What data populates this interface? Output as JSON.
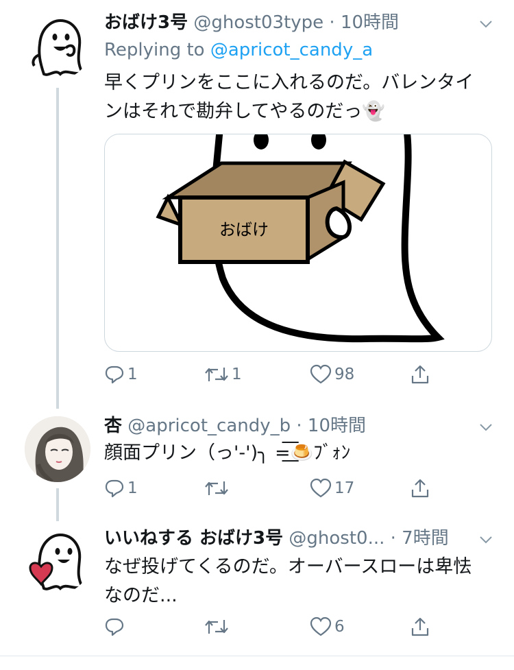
{
  "tweets": [
    {
      "name": "おばけ3号",
      "handle": "@ghost03type",
      "time": "· 10時間",
      "replying_prefix": "Replying to",
      "replying_handle": "@apricot_candy_a",
      "text_line1": "早くプリンをここに入れるのだ。バレンタイ",
      "text_line2": "ンはそれで勘弁してやるのだっ👻",
      "image_label": "おばけ",
      "replies": "1",
      "retweets": "1",
      "likes": "98"
    },
    {
      "name": "杏",
      "handle": "@apricot_candy_b",
      "time": "· 10時間",
      "text": "顔面プリン（っ'-')╮ =͟͟͞͞🍮ﾌﾞｫﾝ",
      "replies": "1",
      "retweets": "",
      "likes": "17"
    },
    {
      "name": "いいねする おばけ3号",
      "handle": "@ghost0...",
      "time": "· 7時間",
      "text_line1": "なぜ投げてくるのだ。オーバースローは卑怯",
      "text_line2": "なのだ...",
      "replies": "",
      "retweets": "",
      "likes": "6"
    }
  ],
  "icons": {
    "reply": "reply-icon",
    "retweet": "retweet-icon",
    "like": "heart-icon",
    "share": "share-icon",
    "caret": "chevron-down-icon"
  },
  "colors": {
    "accent": "#1da1f2",
    "muted": "#657786",
    "text": "#14171a"
  }
}
